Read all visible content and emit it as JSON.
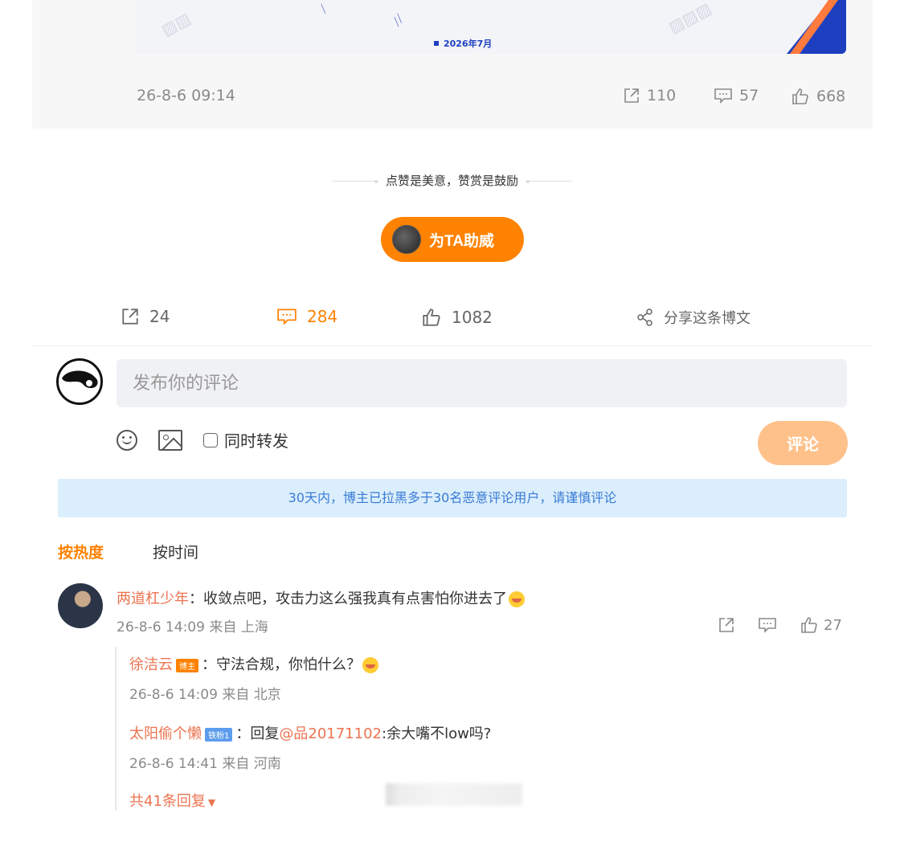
{
  "quoted_card": {
    "legend": "2026年7月",
    "time": "26-8-6 09:14",
    "reposts": "110",
    "comments": "57",
    "likes": "668"
  },
  "support": {
    "tagline": "点赞是美意，赞赏是鼓励",
    "button_label": "为TA助威"
  },
  "actions": {
    "reposts": "24",
    "comments": "284",
    "likes": "1082",
    "share_label": "分享这条博文"
  },
  "composer": {
    "placeholder": "发布你的评论",
    "repost_label": "同时转发",
    "submit_label": "评论"
  },
  "notice": "30天内，博主已拉黑多于30名恶意评论用户，请谨慎评论",
  "sort": {
    "hot": "按热度",
    "time": "按时间"
  },
  "comment": {
    "username": "两道杠少年",
    "text": "：收敛点吧，攻击力这么强我真有点害怕你进去了",
    "meta": "26-8-6 14:09 来自 上海",
    "likes": "27",
    "replies": [
      {
        "username": "徐洁云",
        "badge": "博主",
        "text": "：守法合规，你怕什么？",
        "meta": "26-8-6 14:09 来自 北京"
      },
      {
        "username": "太阳偷个懒",
        "badge": "铁粉1",
        "text_prefix": "：回复",
        "mention": "@品20171102",
        "text_suffix": ":余大嘴不low吗?",
        "meta": "26-8-6 14:41 来自 河南"
      }
    ],
    "more_replies": "共41条回复"
  }
}
